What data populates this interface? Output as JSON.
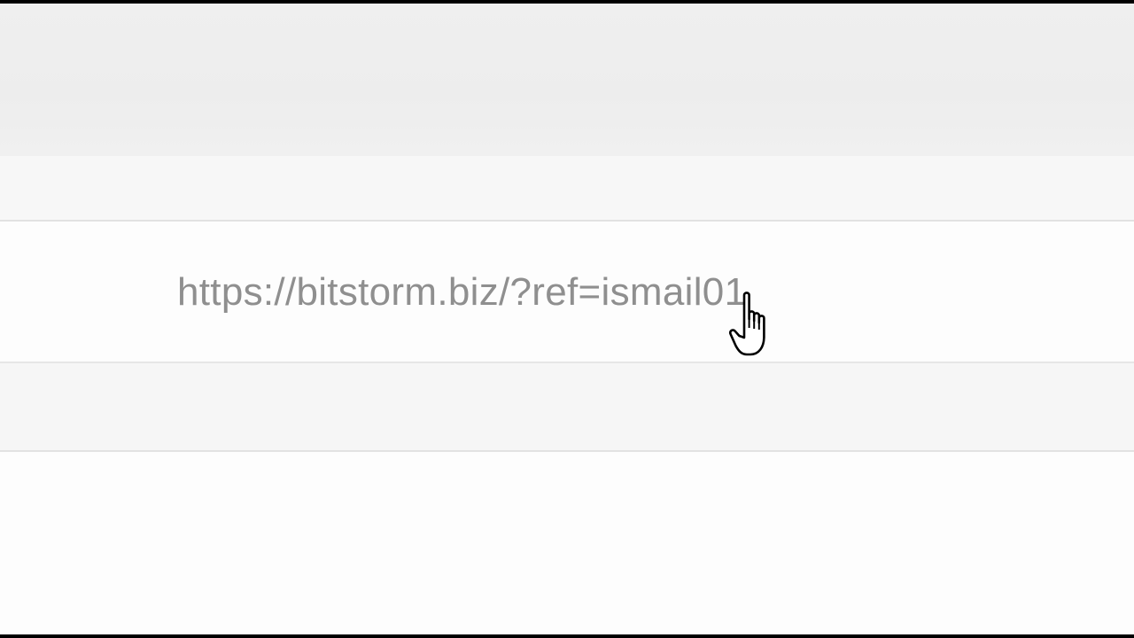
{
  "link": {
    "url": "https://bitstorm.biz/?ref=ismail01"
  },
  "cursor": {
    "icon": "hand-pointer-icon"
  },
  "colors": {
    "link_text": "#8f8f8f",
    "background": "#fbfbfb",
    "divider": "#e2e2e2"
  }
}
